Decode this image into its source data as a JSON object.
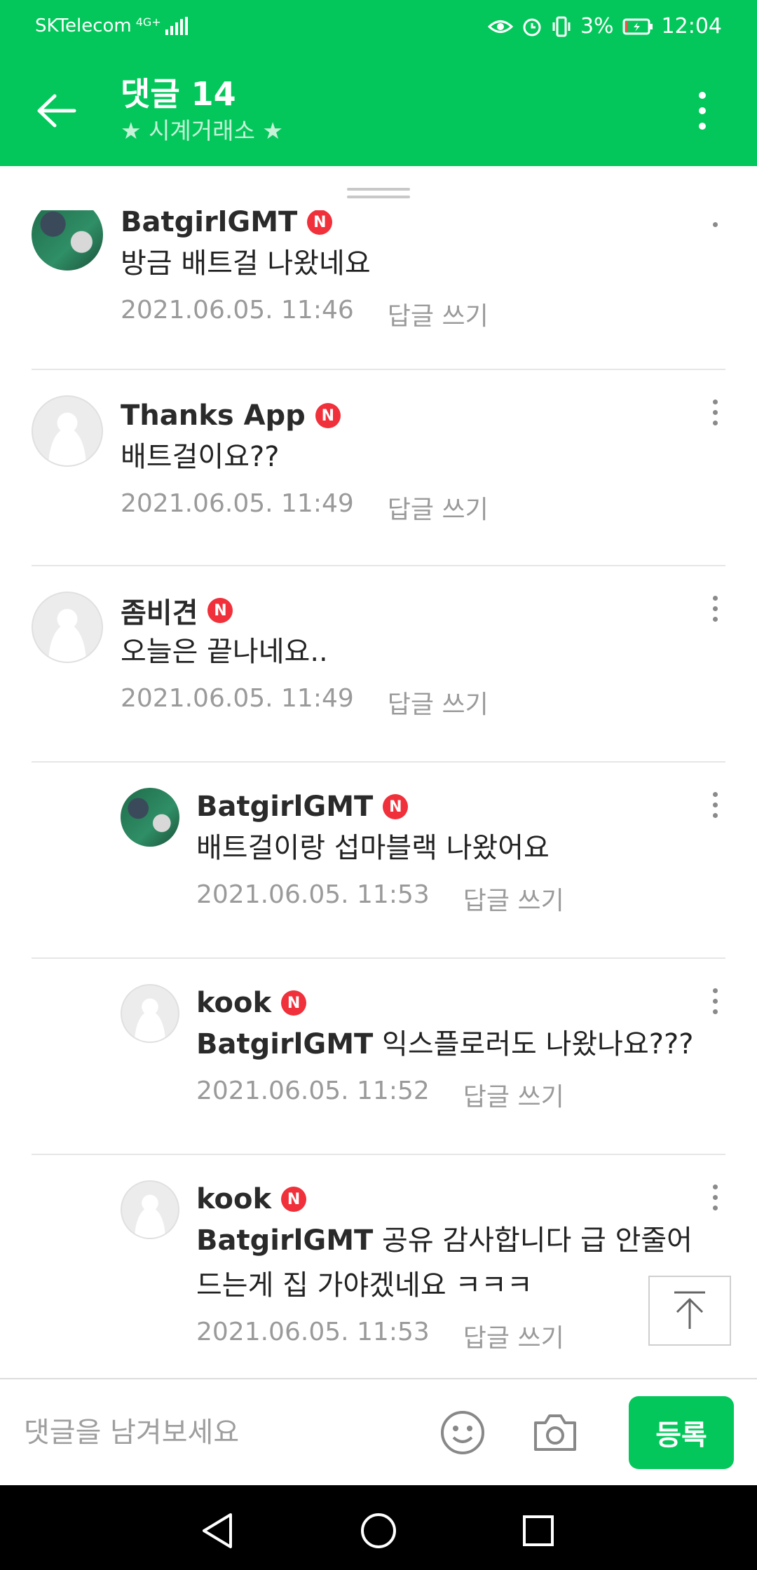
{
  "status_bar": {
    "carrier": "SKTelecom",
    "network": "4G+",
    "battery": "3%",
    "time": "12:04"
  },
  "header": {
    "title": "댓글 14",
    "subtitle": "★ 시계거래소 ★",
    "back_icon": "arrow-left-icon",
    "menu_icon": "more-vertical-icon"
  },
  "comments": [
    {
      "author": "BatgirlGMT",
      "badge": "N",
      "avatar": "photo",
      "reply": false,
      "mention": "",
      "text": "방금 배트걸 나왔네요",
      "date": "2021.06.05. 11:46",
      "reply_label": "답글 쓰기"
    },
    {
      "author": "Thanks App",
      "badge": "N",
      "avatar": "default",
      "reply": false,
      "mention": "",
      "text": "배트걸이요??",
      "date": "2021.06.05. 11:49",
      "reply_label": "답글 쓰기"
    },
    {
      "author": "좀비견",
      "badge": "N",
      "avatar": "default",
      "reply": false,
      "mention": "",
      "text": "오늘은 끝나네요..",
      "date": "2021.06.05. 11:49",
      "reply_label": "답글 쓰기"
    },
    {
      "author": "BatgirlGMT",
      "badge": "N",
      "avatar": "photo",
      "reply": true,
      "mention": "",
      "text": "배트걸이랑 섭마블랙 나왔어요",
      "date": "2021.06.05. 11:53",
      "reply_label": "답글 쓰기"
    },
    {
      "author": "kook",
      "badge": "N",
      "avatar": "default",
      "reply": true,
      "mention": "BatgirlGMT",
      "text": "익스플로러도 나왔나요???",
      "date": "2021.06.05. 11:52",
      "reply_label": "답글 쓰기"
    },
    {
      "author": "kook",
      "badge": "N",
      "avatar": "default",
      "reply": true,
      "mention": "BatgirlGMT",
      "text": "공유 감사합니다 급 안줄어드는게 집 가야겠네요 ㅋㅋㅋ",
      "date": "2021.06.05. 11:53",
      "reply_label": "답글 쓰기"
    }
  ],
  "input_bar": {
    "placeholder": "댓글을 남겨보세요",
    "emoji_icon": "smile-icon",
    "camera_icon": "camera-icon",
    "submit_label": "등록"
  },
  "scroll_top_icon": "arrow-up-icon",
  "colors": {
    "brand": "#03c75a",
    "badge": "#f0303a"
  }
}
